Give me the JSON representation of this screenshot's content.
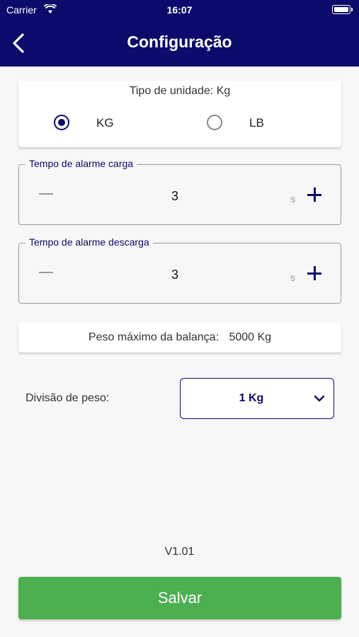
{
  "status_bar": {
    "carrier": "Carrier",
    "time": "16:07"
  },
  "header": {
    "title": "Configuração",
    "back_icon": "chevron-left-icon"
  },
  "unit_type": {
    "title": "Tipo de unidade: Kg",
    "options": [
      {
        "label": "KG",
        "selected": true
      },
      {
        "label": "LB",
        "selected": false
      }
    ]
  },
  "alarm_load": {
    "legend": "Tempo de alarme carga",
    "value": "3",
    "unit": "s"
  },
  "alarm_unload": {
    "legend": "Tempo de alarme descarga",
    "value": "3",
    "unit": "s"
  },
  "max_weight": {
    "label": "Peso máximo da balança:",
    "value": "5000 Kg"
  },
  "weight_division": {
    "label": "Divisão de peso:",
    "value": "1 Kg"
  },
  "version": "V1.01",
  "save_label": "Salvar",
  "colors": {
    "primary": "#0b0b6b",
    "save": "#4caf50",
    "background": "#f7f7f7"
  }
}
